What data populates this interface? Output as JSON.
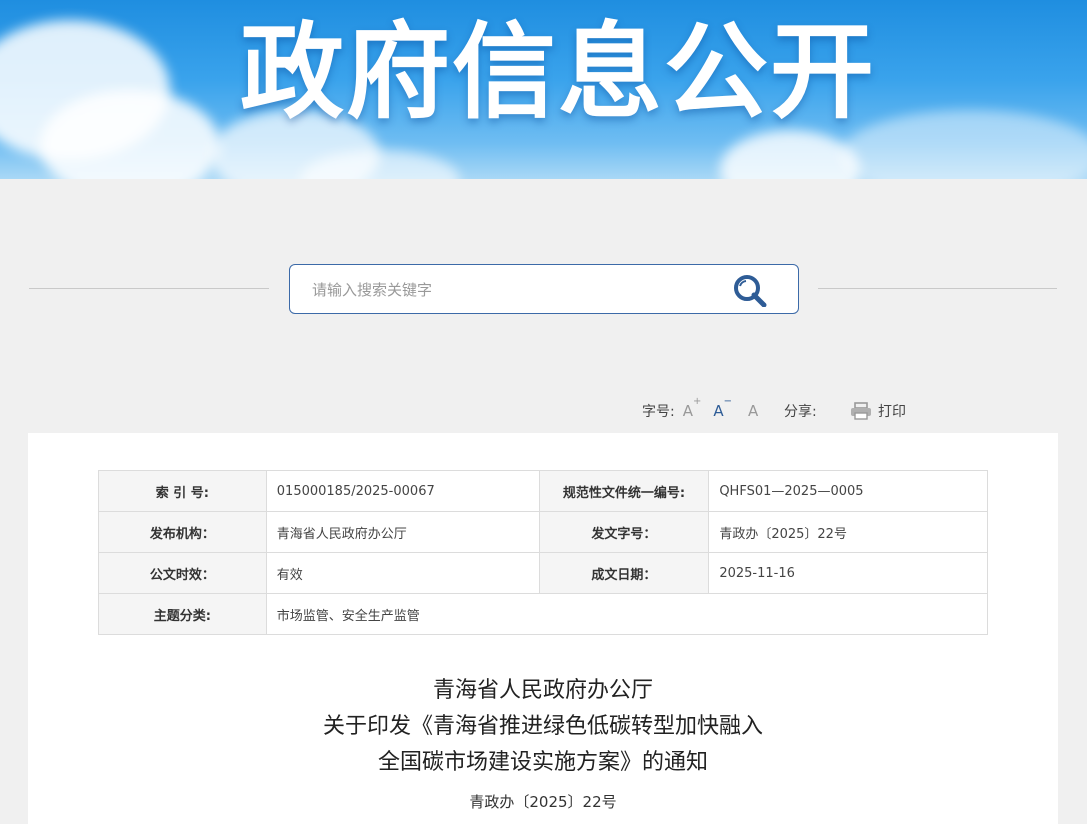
{
  "banner": {
    "title": "政府信息公开"
  },
  "search": {
    "placeholder": "请输入搜索关键字"
  },
  "toolbar": {
    "font_label": "字号:",
    "font_large": "A",
    "font_medium": "A",
    "font_small": "A",
    "share_label": "分享:",
    "print_label": "打印"
  },
  "info": {
    "rows": [
      [
        {
          "label": "索 引 号:",
          "value": "015000185/2025-00067"
        },
        {
          "label": "规范性文件统一编号:",
          "value": "QHFS01—2025—0005"
        }
      ],
      [
        {
          "label": "发布机构：",
          "value": "青海省人民政府办公厅"
        },
        {
          "label": "发文字号：",
          "value": "青政办〔2025〕22号"
        }
      ],
      [
        {
          "label": "公文时效：",
          "value": "有效"
        },
        {
          "label": "成文日期：",
          "value": "2025-11-16"
        }
      ],
      [
        {
          "label": "主题分类:",
          "value": "市场监管、安全生产监管"
        }
      ]
    ]
  },
  "document": {
    "title_lines": [
      "青海省人民政府办公厅",
      "关于印发《青海省推进绿色低碳转型加快融入",
      "全国碳市场建设实施方案》的通知"
    ],
    "doc_number": "青政办〔2025〕22号"
  },
  "colors": {
    "accent": "#3c6aa8",
    "banner": "#2a96e6"
  }
}
